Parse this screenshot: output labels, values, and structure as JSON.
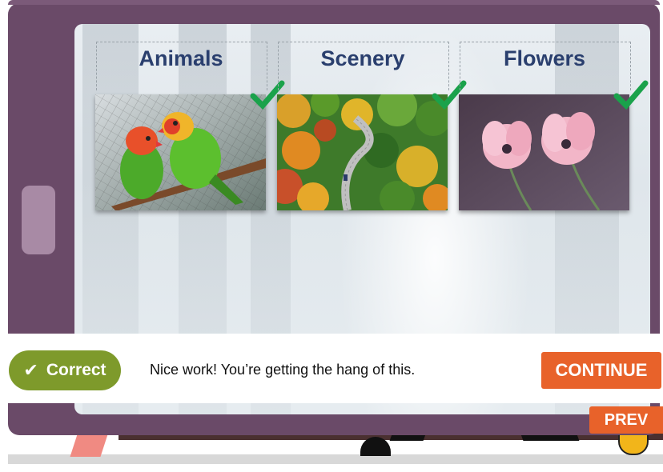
{
  "categories": [
    {
      "title": "Animals",
      "image_icon": "lovebirds-photo",
      "checked": true
    },
    {
      "title": "Scenery",
      "image_icon": "autumn-forest-road-photo",
      "checked": true
    },
    {
      "title": "Flowers",
      "image_icon": "pink-tulips-photo",
      "checked": true
    }
  ],
  "feedback": {
    "status_label": "Correct",
    "status_icon": "checkmark-icon",
    "message": "Nice work! You’re getting the hang of this."
  },
  "nav": {
    "continue_label": "CONTINUE",
    "prev_label": "PREV"
  },
  "colors": {
    "device_frame": "#6a4a68",
    "title_text": "#2a3f6e",
    "check_green": "#1aa24b",
    "correct_pill": "#7e9a2b",
    "button_orange": "#e8622a"
  }
}
